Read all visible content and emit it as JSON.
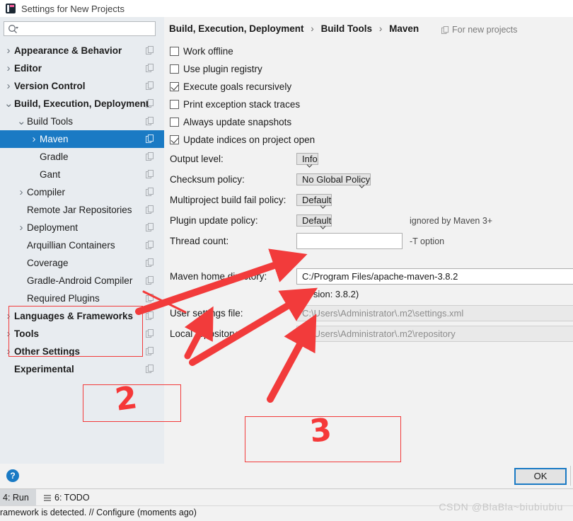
{
  "window": {
    "title": "Settings for New Projects",
    "logo_icon": "intellij-idea-icon"
  },
  "sidebar": {
    "search": {
      "value": "",
      "placeholder": "",
      "icon": "search-icon"
    },
    "copy_icon": "copy-settings-icon",
    "items": [
      {
        "label": "Appearance & Behavior",
        "indent": 0,
        "arrow": "chevron-right",
        "bold": true,
        "selected": false
      },
      {
        "label": "Editor",
        "indent": 0,
        "arrow": "chevron-right",
        "bold": true,
        "selected": false
      },
      {
        "label": "Version Control",
        "indent": 0,
        "arrow": "chevron-right",
        "bold": true,
        "selected": false
      },
      {
        "label": "Build, Execution, Deployment",
        "indent": 0,
        "arrow": "chevron-down",
        "bold": true,
        "selected": false
      },
      {
        "label": "Build Tools",
        "indent": 1,
        "arrow": "chevron-down",
        "bold": false,
        "selected": false
      },
      {
        "label": "Maven",
        "indent": 2,
        "arrow": "chevron-right",
        "bold": false,
        "selected": true
      },
      {
        "label": "Gradle",
        "indent": 2,
        "arrow": "",
        "bold": false,
        "selected": false
      },
      {
        "label": "Gant",
        "indent": 2,
        "arrow": "",
        "bold": false,
        "selected": false
      },
      {
        "label": "Compiler",
        "indent": 1,
        "arrow": "chevron-right",
        "bold": false,
        "selected": false
      },
      {
        "label": "Remote Jar Repositories",
        "indent": 1,
        "arrow": "",
        "bold": false,
        "selected": false
      },
      {
        "label": "Deployment",
        "indent": 1,
        "arrow": "chevron-right",
        "bold": false,
        "selected": false
      },
      {
        "label": "Arquillian Containers",
        "indent": 1,
        "arrow": "",
        "bold": false,
        "selected": false
      },
      {
        "label": "Coverage",
        "indent": 1,
        "arrow": "",
        "bold": false,
        "selected": false
      },
      {
        "label": "Gradle-Android Compiler",
        "indent": 1,
        "arrow": "",
        "bold": false,
        "selected": false
      },
      {
        "label": "Required Plugins",
        "indent": 1,
        "arrow": "",
        "bold": false,
        "selected": false
      },
      {
        "label": "Languages & Frameworks",
        "indent": 0,
        "arrow": "chevron-right",
        "bold": true,
        "selected": false
      },
      {
        "label": "Tools",
        "indent": 0,
        "arrow": "chevron-right",
        "bold": true,
        "selected": false
      },
      {
        "label": "Other Settings",
        "indent": 0,
        "arrow": "chevron-right",
        "bold": true,
        "selected": false
      },
      {
        "label": "Experimental",
        "indent": 0,
        "arrow": "",
        "bold": true,
        "selected": false
      }
    ]
  },
  "content": {
    "breadcrumb": {
      "part1": "Build, Execution, Deployment",
      "part2": "Build Tools",
      "part3": "Maven",
      "separator": "›"
    },
    "for_new_projects": {
      "label": "For new projects",
      "icon": "copy-settings-icon"
    },
    "checkboxes": [
      {
        "label": "Work offline",
        "checked": false,
        "mnemonic": "o"
      },
      {
        "label": "Use plugin registry",
        "checked": false,
        "mnemonic": "r"
      },
      {
        "label": "Execute goals recursively",
        "checked": true,
        "mnemonic": "g"
      },
      {
        "label": "Print exception stack traces",
        "checked": false,
        "mnemonic": "e"
      },
      {
        "label": "Always update snapshots",
        "checked": false,
        "mnemonic": "s"
      },
      {
        "label": "Update indices on project open",
        "checked": true,
        "mnemonic": ""
      }
    ],
    "fields": {
      "output_level": {
        "label": "Output level:",
        "value": "Info",
        "type": "combo"
      },
      "checksum_policy": {
        "label": "Checksum policy:",
        "value": "No Global Policy",
        "type": "combo"
      },
      "multiproject": {
        "label": "Multiproject build fail policy:",
        "value": "Default",
        "type": "combo"
      },
      "plugin_update": {
        "label": "Plugin update policy:",
        "value": "Default",
        "type": "combo",
        "hint": "ignored by Maven 3+"
      },
      "thread_count": {
        "label": "Thread count:",
        "value": "",
        "type": "text",
        "hint": "-T option"
      },
      "maven_home": {
        "label": "Maven home directory:",
        "value": "C:/Program Files/apache-maven-3.8.2",
        "type": "text"
      },
      "version_note": "(Version: 3.8.2)",
      "user_settings": {
        "label": "User settings file:",
        "value": "C:\\Users\\Administrator\\.m2\\settings.xml",
        "type": "text",
        "disabled": true
      },
      "local_repo": {
        "label": "Local repository:",
        "value": "C:\\Users\\Administrator\\.m2\\repository",
        "type": "text",
        "disabled": true
      }
    },
    "chevron_icon": "chevron-down-icon"
  },
  "footer": {
    "help_icon": "help-icon",
    "help_glyph": "?",
    "ok_label": "OK"
  },
  "ide": {
    "tab_run": "4: Run",
    "tab_todo": "6: TODO",
    "todo_icon": "list-icon",
    "status_message": "ramework is detected. // Configure (moments ago)",
    "watermark": "CSDN @BlaBla~biubiubiu"
  },
  "annotations": {
    "box_sidebar": {
      "name": "annotation-box-1"
    },
    "number_2": "2",
    "number_3": "3",
    "arrow_color": "#f23b3b"
  }
}
